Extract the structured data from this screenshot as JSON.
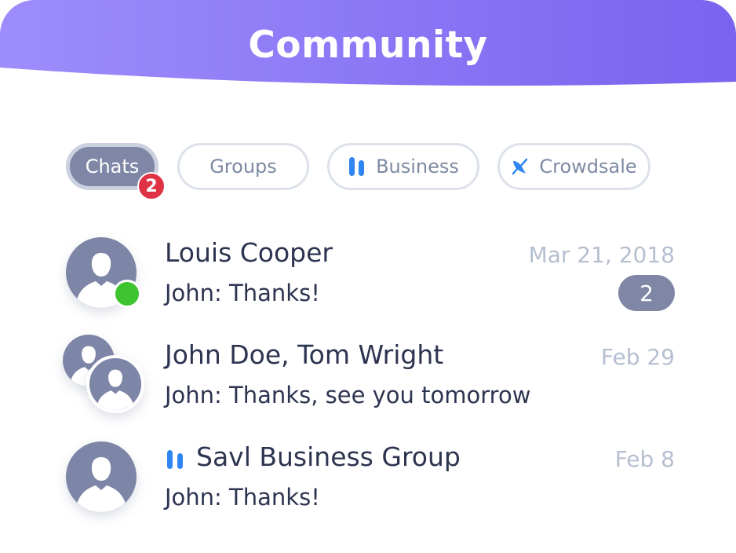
{
  "header": {
    "title": "Community"
  },
  "tabs": [
    {
      "label": "Chats",
      "badge": "2",
      "active": true
    },
    {
      "label": "Groups",
      "active": false
    },
    {
      "label": "Business",
      "icon": "business-bars-icon",
      "active": false
    },
    {
      "label": "Crowdsale",
      "icon": "satellite-dish-icon",
      "active": false
    }
  ],
  "chats": [
    {
      "name": "Louis Cooper",
      "preview": "John: Thanks!",
      "date": "Mar 21, 2018",
      "unread": "2",
      "online": true
    },
    {
      "name": "John Doe, Tom Wright",
      "preview": "John: Thanks, see you tomorrow",
      "date": "Feb 29",
      "group": true
    },
    {
      "name": "Savl Business Group",
      "preview": "John: Thanks!",
      "date": "Feb 8",
      "business": true
    }
  ],
  "colors": {
    "header_gradient_start": "#9d8dfc",
    "header_gradient_end": "#7a63ee",
    "avatar": "#7e86a8",
    "online": "#3ec431",
    "badge_red": "#e03245",
    "business_blue": "#2f86f2"
  }
}
